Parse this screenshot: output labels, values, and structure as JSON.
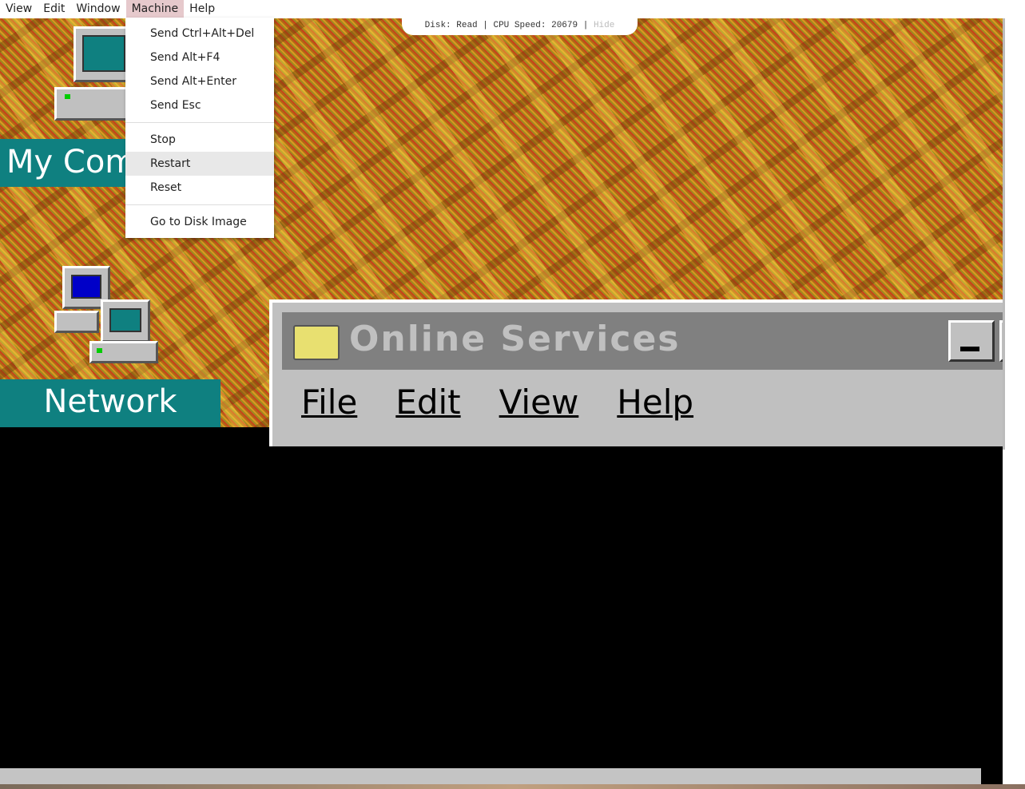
{
  "menubar": {
    "items": [
      "View",
      "Edit",
      "Window",
      "Machine",
      "Help"
    ],
    "active": "Machine"
  },
  "status": {
    "disk": "Disk: Read",
    "sep": "|",
    "cpu": "CPU Speed: 20679",
    "hide": "Hide"
  },
  "machine_menu": {
    "group1": [
      "Send Ctrl+Alt+Del",
      "Send Alt+F4",
      "Send Alt+Enter",
      "Send Esc"
    ],
    "group2": [
      "Stop",
      "Restart",
      "Reset"
    ],
    "group3": [
      "Go to Disk Image"
    ],
    "hovered": "Restart"
  },
  "desktop": {
    "icons": [
      {
        "label": "My Com",
        "icon": "my-computer-icon"
      },
      {
        "label": "Network",
        "icon": "network-icon"
      }
    ],
    "window": {
      "title": "Online Services",
      "menu": [
        "File",
        "Edit",
        "View",
        "Help"
      ]
    }
  },
  "colors": {
    "desktop_label": "#0f8080",
    "menu_active": "#e6c9cc",
    "win_gray": "#c0c0c0"
  }
}
